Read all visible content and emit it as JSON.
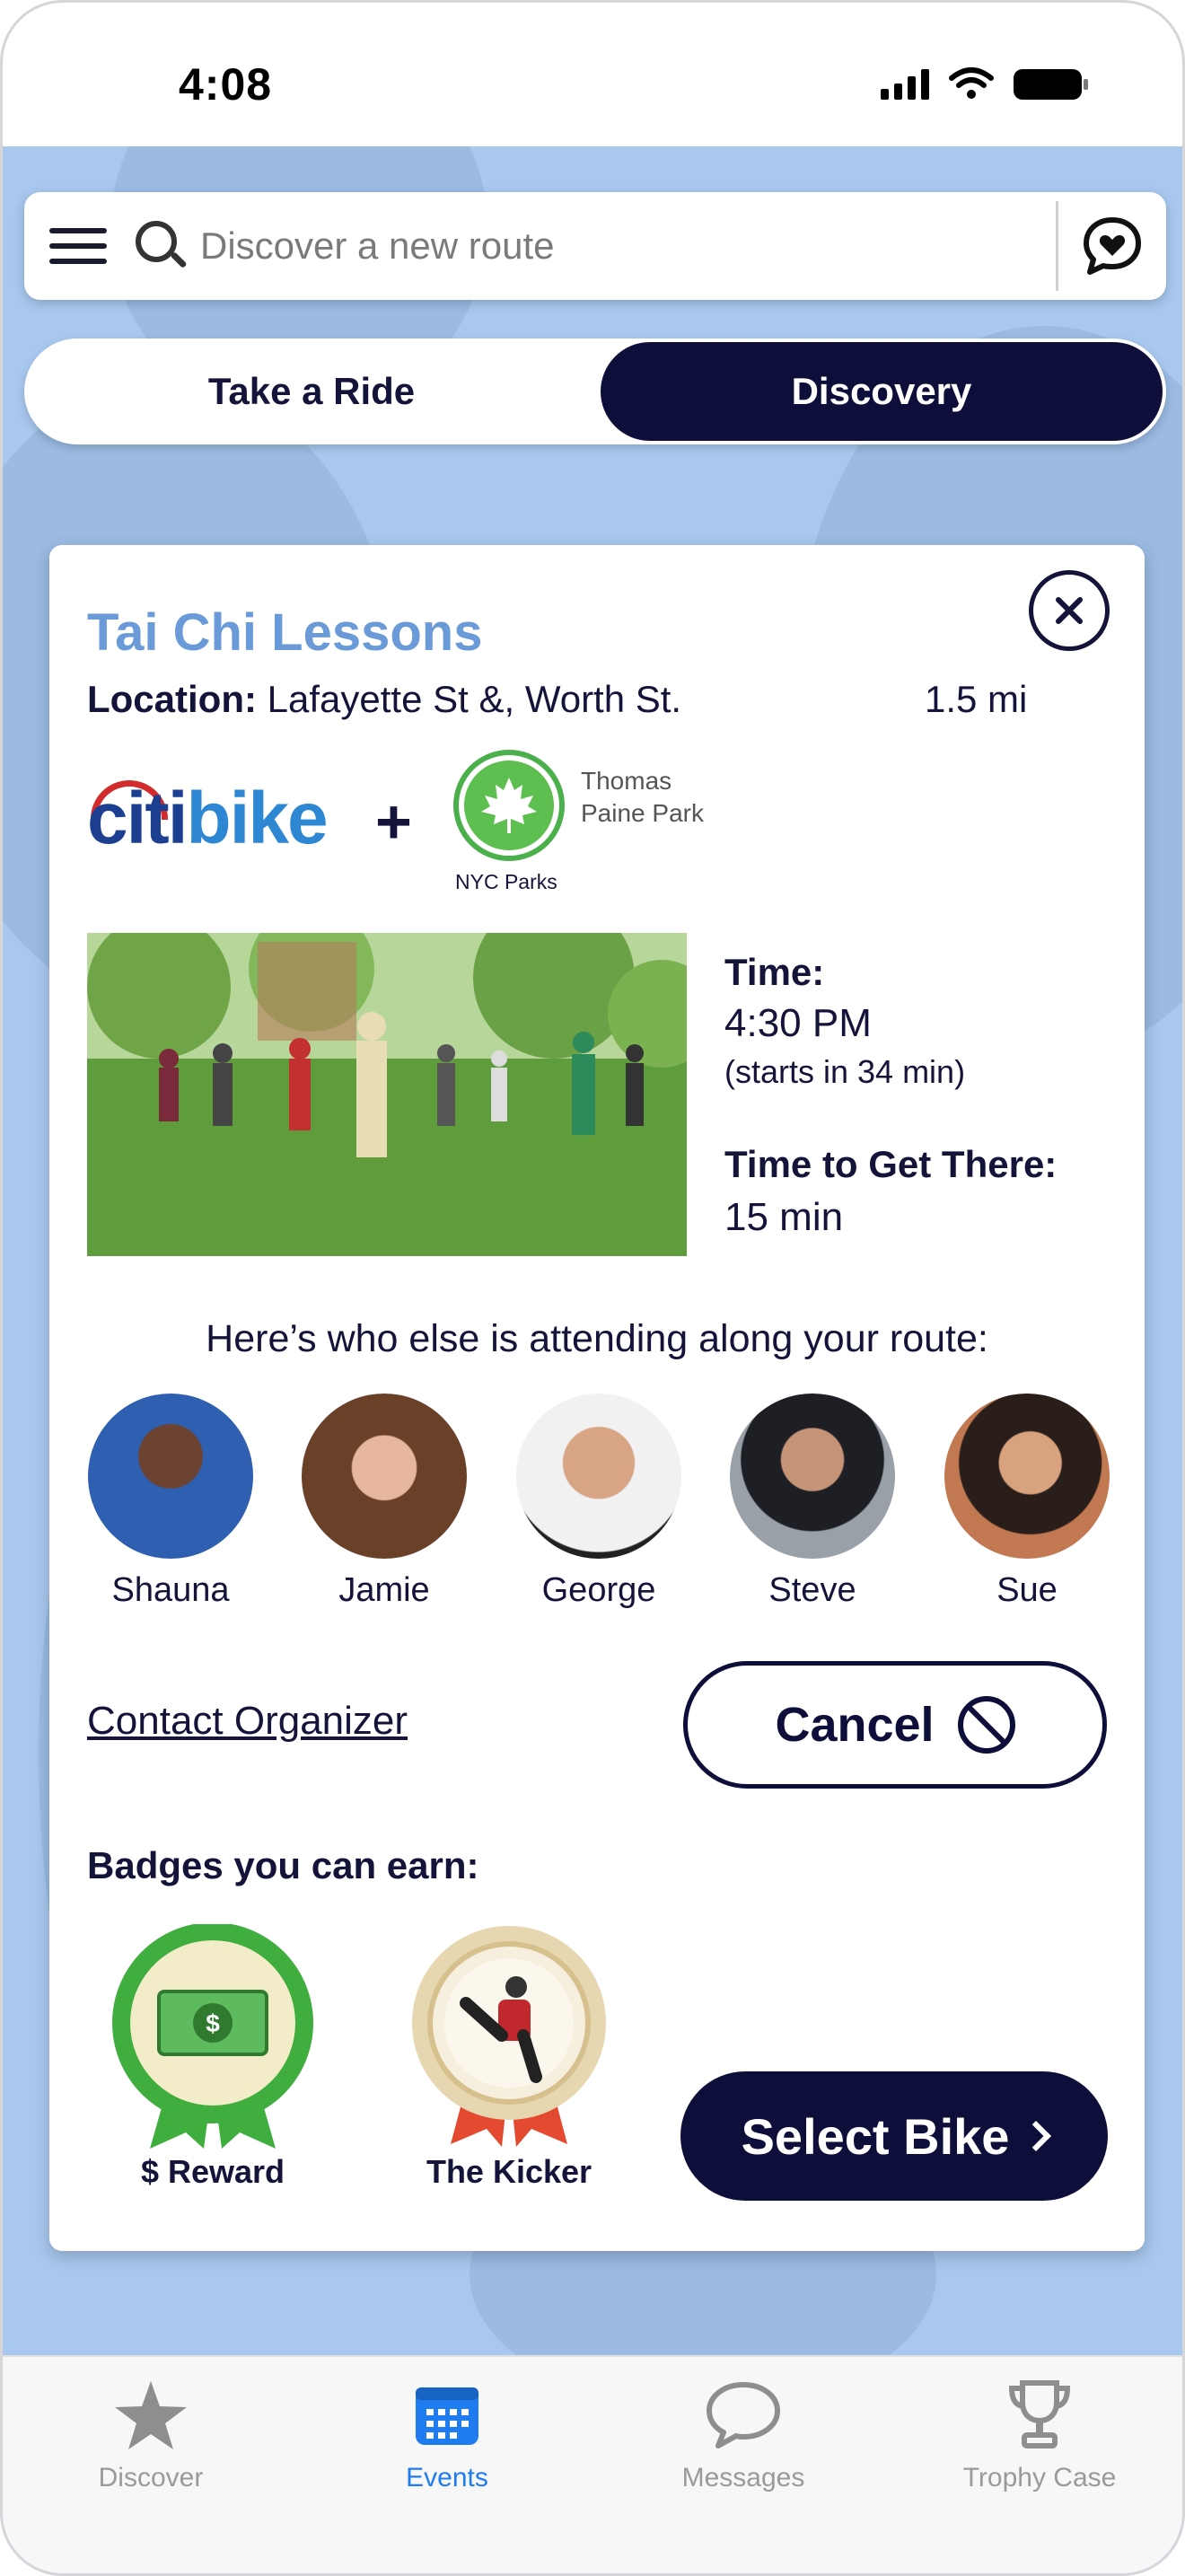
{
  "status_bar": {
    "time": "4:08"
  },
  "search": {
    "placeholder": "Discover a new route"
  },
  "segment": {
    "take_a_ride": "Take a Ride",
    "discovery": "Discovery",
    "active": "Discovery"
  },
  "event": {
    "title": "Tai Chi Lessons",
    "location_label": "Location:",
    "location": "Lafayette St &, Worth St.",
    "distance": "1.5 mi",
    "partner_logo": "citi bike",
    "partner_logo_parts": {
      "citi": "citi",
      "bike": "bike"
    },
    "plus": "+",
    "parks_caption": "NYC Parks",
    "park_name": "Thomas Paine Park",
    "time_label": "Time:",
    "time": "4:30 PM",
    "time_note": "(starts in 34 min)",
    "travel_label": "Time to Get There:",
    "travel_time": "15 min",
    "attending_heading": "Here’s who else is attending along your route:",
    "attendees": [
      {
        "name": "Shauna",
        "color": "#2f5fb0"
      },
      {
        "name": "Jamie",
        "color": "#8a5a3a"
      },
      {
        "name": "George",
        "color": "#c79a78"
      },
      {
        "name": "Steve",
        "color": "#5a5f6e"
      },
      {
        "name": "Sue",
        "color": "#a56f52"
      }
    ],
    "contact_organizer": "Contact Organizer",
    "cancel": "Cancel",
    "badges_heading": "Badges you can earn:",
    "badges": [
      {
        "caption": "$ Reward"
      },
      {
        "caption": "The Kicker"
      }
    ],
    "select_bike": "Select Bike"
  },
  "tabs": [
    {
      "label": "Discover",
      "icon": "star-icon",
      "active": false
    },
    {
      "label": "Events",
      "icon": "calendar-icon",
      "active": true
    },
    {
      "label": "Messages",
      "icon": "speech-bubble-icon",
      "active": false
    },
    {
      "label": "Trophy Case",
      "icon": "trophy-icon",
      "active": false
    }
  ],
  "colors": {
    "primary": "#0e0e3a",
    "title_accent": "#6a9ad8",
    "background": "#a9c8ef",
    "active_tab": "#1f7cf0"
  }
}
